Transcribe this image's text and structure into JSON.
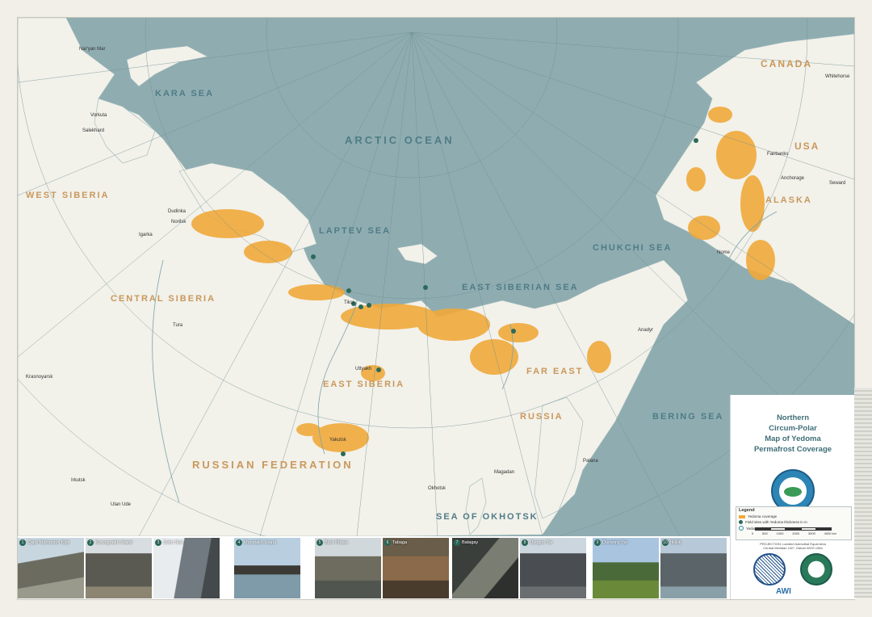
{
  "map": {
    "title_lines": [
      "Northern",
      "Circum-Polar",
      "Map of Yedoma",
      "Permafrost Coverage"
    ],
    "seas": [
      "KARA SEA",
      "ARCTIC OCEAN",
      "LAPTEV SEA",
      "EAST SIBERIAN SEA",
      "CHUKCHI SEA",
      "BERING SEA",
      "SEA OF OKHOTSK"
    ],
    "regions": [
      "CANADA",
      "USA",
      "ALASKA",
      "WEST SIBERIA",
      "CENTRAL SIBERIA",
      "EAST SIBERIA",
      "FAR EAST",
      "RUSSIA",
      "RUSSIAN FEDERATION"
    ],
    "cities": [
      "Nar'yan Mar",
      "Vorkuta",
      "Salekhard",
      "Dudinka",
      "Norilsk",
      "Igarka",
      "Tura",
      "Krasnoyarsk",
      "Irkutsk",
      "Ulan Ude",
      "Yakutsk",
      "Uttyakh",
      "Tiksi",
      "Magadan",
      "Okhotsk",
      "Palana",
      "Anadyr",
      "Whitehorse",
      "Fairbanks",
      "Anchorage",
      "Seward",
      "Nome"
    ]
  },
  "legend": {
    "title": "Legend",
    "items": [
      "Yedoma coverage",
      "Field sites with Yedoma thickness in m",
      "Yedoma photos"
    ],
    "scale_labels": [
      "0",
      "500",
      "1000",
      "2000",
      "3000",
      "4000 km"
    ],
    "projection": [
      "PROJECTION: Lambert Azimuthal Equal Area",
      "Central Meridian 140°, Datum WGS 1984"
    ]
  },
  "logos": {
    "awi": "AWI"
  },
  "photos": [
    {
      "n": "1",
      "label": "Cape Mamontov Klyk"
    },
    {
      "n": "2",
      "label": "Kurungnakh Island"
    },
    {
      "n": "3",
      "label": "Sobo Sise"
    },
    {
      "n": "4",
      "label": "Muostakh Island"
    },
    {
      "n": "5",
      "label": "Buor Khaya"
    },
    {
      "n": "6",
      "label": "Tabaga"
    },
    {
      "n": "7",
      "label": "Batagay"
    },
    {
      "n": "8",
      "label": "Oyogos Yar"
    },
    {
      "n": "9",
      "label": "Duvanny Yar"
    },
    {
      "n": "10",
      "label": "Itkillik"
    }
  ],
  "colors": {
    "water": "#8fadb1",
    "land": "#f2f1ea",
    "yedoma": "#f0a93a",
    "sea_label": "#4f7c86",
    "land_label": "#c9985c",
    "title": "#3f6e78"
  }
}
